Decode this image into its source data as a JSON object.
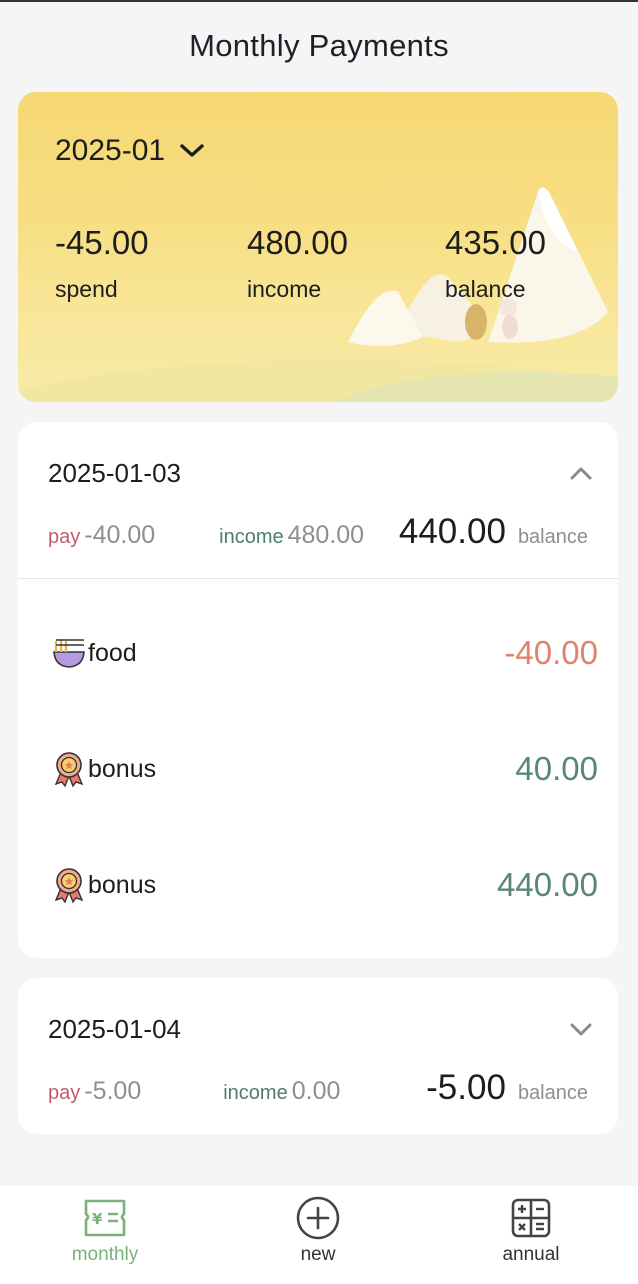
{
  "header": {
    "title": "Monthly Payments"
  },
  "summary": {
    "month": "2025-01",
    "spend_value": "-45.00",
    "spend_label": "spend",
    "income_value": "480.00",
    "income_label": "income",
    "balance_value": "435.00",
    "balance_label": "balance"
  },
  "days": [
    {
      "date": "2025-01-03",
      "expanded": true,
      "pay_label": "pay",
      "pay_value": "-40.00",
      "income_label": "income",
      "income_value": "480.00",
      "balance_value": "440.00",
      "balance_label": "balance",
      "items": [
        {
          "icon": "noodle-bowl-icon",
          "label": "food",
          "amount": "-40.00"
        },
        {
          "icon": "medal-icon",
          "label": "bonus",
          "amount": "40.00"
        },
        {
          "icon": "medal-icon",
          "label": "bonus",
          "amount": "440.00"
        }
      ]
    },
    {
      "date": "2025-01-04",
      "expanded": false,
      "pay_label": "pay",
      "pay_value": "-5.00",
      "income_label": "income",
      "income_value": "0.00",
      "balance_value": "-5.00",
      "balance_label": "balance"
    }
  ],
  "tabbar": {
    "tabs": [
      {
        "label": "monthly",
        "icon": "bill-icon",
        "active": true
      },
      {
        "label": "new",
        "icon": "plus-circle-icon",
        "active": false
      },
      {
        "label": "annual",
        "icon": "calculator-icon",
        "active": false
      }
    ]
  },
  "colors": {
    "accent": "#7ab07a",
    "expense": "#e0826f",
    "income": "#5a8675",
    "pay_label": "#c25b6c",
    "summary_bg": "#f6d873"
  }
}
